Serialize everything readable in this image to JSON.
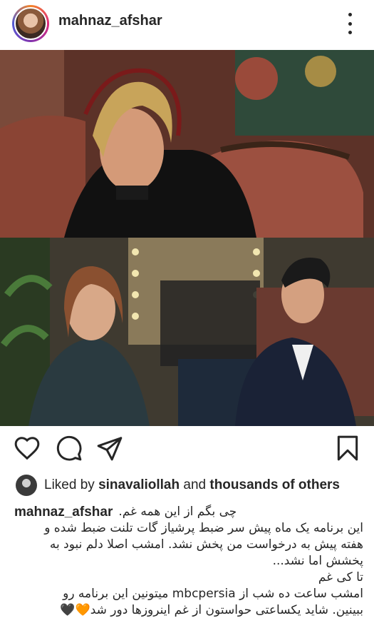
{
  "post": {
    "username": "mahnaz_afshar",
    "liked": {
      "prefix": "Liked by",
      "user": "sinavaliollah",
      "conjunction": "and",
      "others": "thousands of others"
    },
    "caption": {
      "username": "mahnaz_afshar",
      "first_line": "چی بگم از این همه غم.",
      "lines": [
        "این برنامه یک ماه پیش سر ضبط پرشیاز گات تلنت ضبط شده و",
        "هفته پیش به درخواست من پخش نشد. امشب اصلا دلم نبود به",
        "پخشش اما نشد...",
        "تا کی غم",
        "امشب ساعت ده شب از mbcpersia میتونین این برنامه رو",
        "ببینین. شاید یکساعتی حواستون از غم اینروزها دور شد🧡🖤"
      ]
    }
  },
  "icons": {
    "more": "more-vertical-icon",
    "like": "heart-icon",
    "comment": "comment-icon",
    "share": "share-icon",
    "save": "bookmark-icon"
  },
  "colors": {
    "text": "#262626",
    "background": "#ffffff"
  }
}
